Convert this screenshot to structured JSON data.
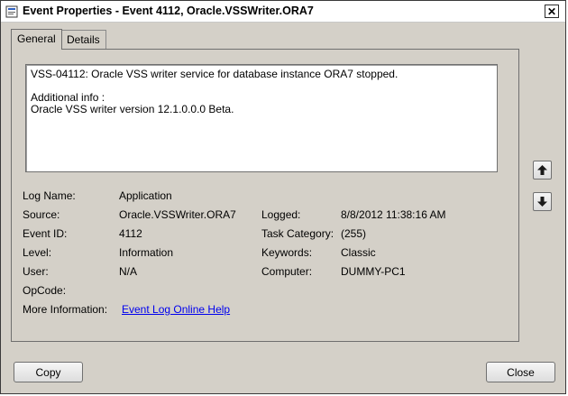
{
  "window": {
    "title": "Event Properties - Event 4112, Oracle.VSSWriter.ORA7",
    "close_glyph": "✕"
  },
  "tabs": [
    {
      "label": "General",
      "active": true
    },
    {
      "label": "Details",
      "active": false
    }
  ],
  "description": {
    "line1": "VSS-04112: Oracle VSS writer service for database instance ORA7 stopped.",
    "line2": "Additional info :",
    "line3": "Oracle VSS writer version 12.1.0.0.0 Beta."
  },
  "fields": {
    "log_name": {
      "label": "Log Name:",
      "value": "Application"
    },
    "source": {
      "label": "Source:",
      "value": "Oracle.VSSWriter.ORA7"
    },
    "logged": {
      "label": "Logged:",
      "value": "8/8/2012 11:38:16 AM"
    },
    "event_id": {
      "label": "Event ID:",
      "value": "4112"
    },
    "task_category": {
      "label": "Task Category:",
      "value": "(255)"
    },
    "level": {
      "label": "Level:",
      "value": "Information"
    },
    "keywords": {
      "label": "Keywords:",
      "value": "Classic"
    },
    "user": {
      "label": "User:",
      "value": "N/A"
    },
    "computer": {
      "label": "Computer:",
      "value": "DUMMY-PC1"
    },
    "opcode": {
      "label": "OpCode:",
      "value": ""
    },
    "more_information": {
      "label": "More Information:",
      "link": "Event Log Online Help"
    }
  },
  "nav": {
    "up_icon": "arrow-up-icon",
    "down_icon": "arrow-down-icon"
  },
  "buttons": {
    "copy": "Copy",
    "close": "Close"
  },
  "colors": {
    "dialog_bg": "#d4d0c8",
    "link": "#0000ee"
  }
}
